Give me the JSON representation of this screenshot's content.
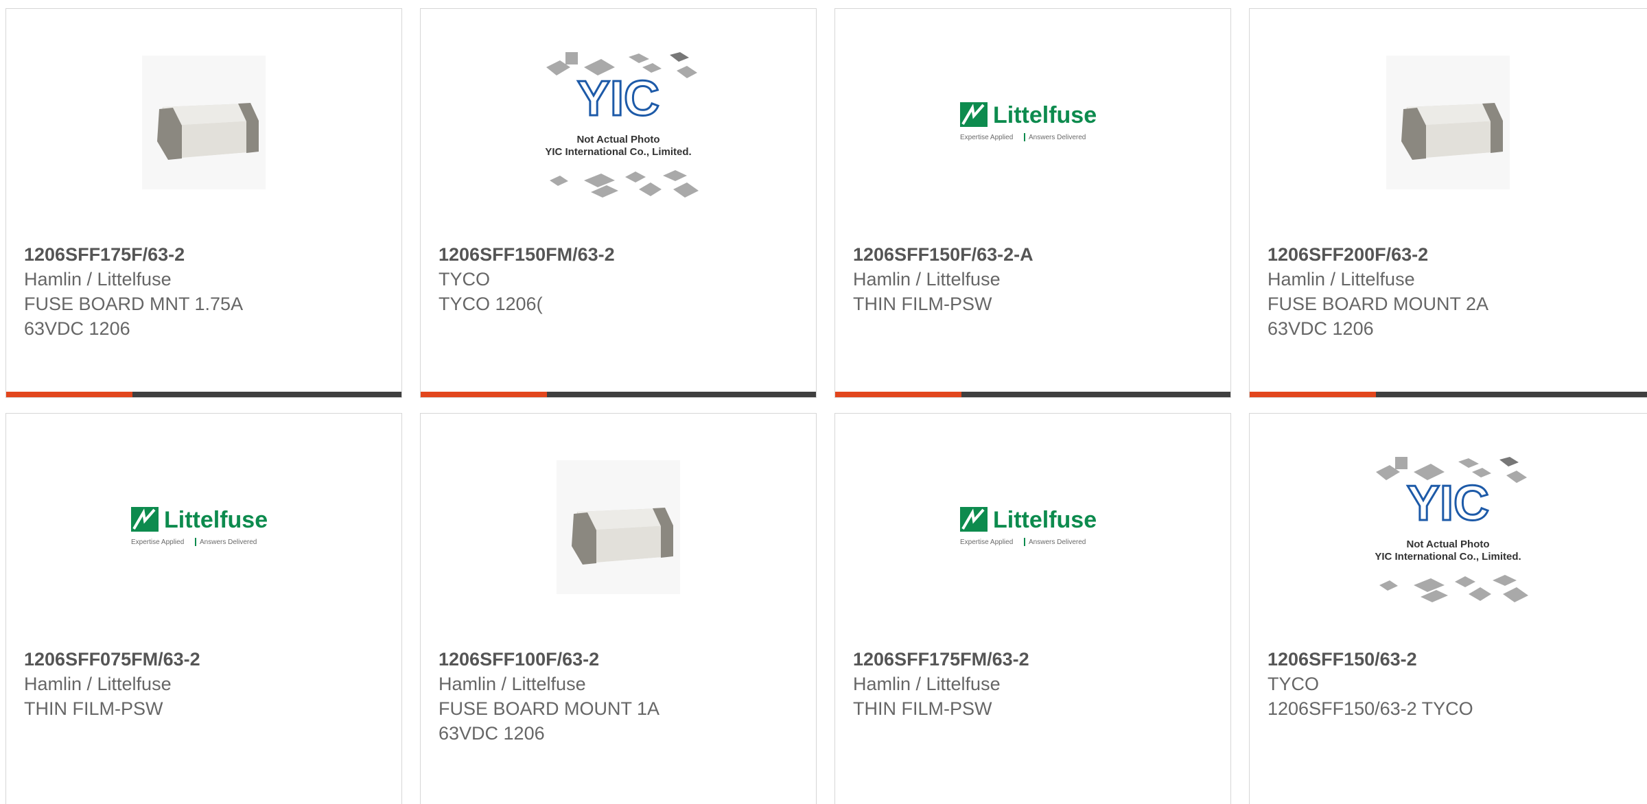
{
  "accent_color": "#e2461d",
  "bar_color": "#3f3f3f",
  "products": [
    {
      "part_number": "1206SFF175F/63-2",
      "manufacturer": "Hamlin / Littelfuse",
      "description": "FUSE BOARD MNT 1.75A\n63VDC 1206",
      "image": "chip-photo"
    },
    {
      "part_number": "1206SFF150FM/63-2",
      "manufacturer": "TYCO",
      "description": "TYCO 1206(",
      "image": "yic-placeholder",
      "placeholder": {
        "brand": "YIC",
        "line1": "Not Actual Photo",
        "line2": "YIC International Co., Limited."
      }
    },
    {
      "part_number": "1206SFF150F/63-2-A",
      "manufacturer": "Hamlin / Littelfuse",
      "description": "THIN FILM-PSW",
      "image": "littelfuse-logo",
      "logo": {
        "name": "Littelfuse",
        "tagline_left": "Expertise Applied",
        "tagline_right": "Answers Delivered"
      }
    },
    {
      "part_number": "1206SFF200F/63-2",
      "manufacturer": "Hamlin / Littelfuse",
      "description": "FUSE BOARD MOUNT 2A\n63VDC 1206",
      "image": "chip-photo"
    },
    {
      "part_number": "1206SFF075FM/63-2",
      "manufacturer": "Hamlin / Littelfuse",
      "description": "THIN FILM-PSW",
      "image": "littelfuse-logo",
      "logo": {
        "name": "Littelfuse",
        "tagline_left": "Expertise Applied",
        "tagline_right": "Answers Delivered"
      }
    },
    {
      "part_number": "1206SFF100F/63-2",
      "manufacturer": "Hamlin / Littelfuse",
      "description": "FUSE BOARD MOUNT 1A\n63VDC 1206",
      "image": "chip-photo"
    },
    {
      "part_number": "1206SFF175FM/63-2",
      "manufacturer": "Hamlin / Littelfuse",
      "description": "THIN FILM-PSW",
      "image": "littelfuse-logo",
      "logo": {
        "name": "Littelfuse",
        "tagline_left": "Expertise Applied",
        "tagline_right": "Answers Delivered"
      }
    },
    {
      "part_number": "1206SFF150/63-2",
      "manufacturer": "TYCO",
      "description": "1206SFF150/63-2 TYCO",
      "image": "yic-placeholder",
      "placeholder": {
        "brand": "YIC",
        "line1": "Not Actual Photo",
        "line2": "YIC International Co., Limited."
      }
    }
  ]
}
